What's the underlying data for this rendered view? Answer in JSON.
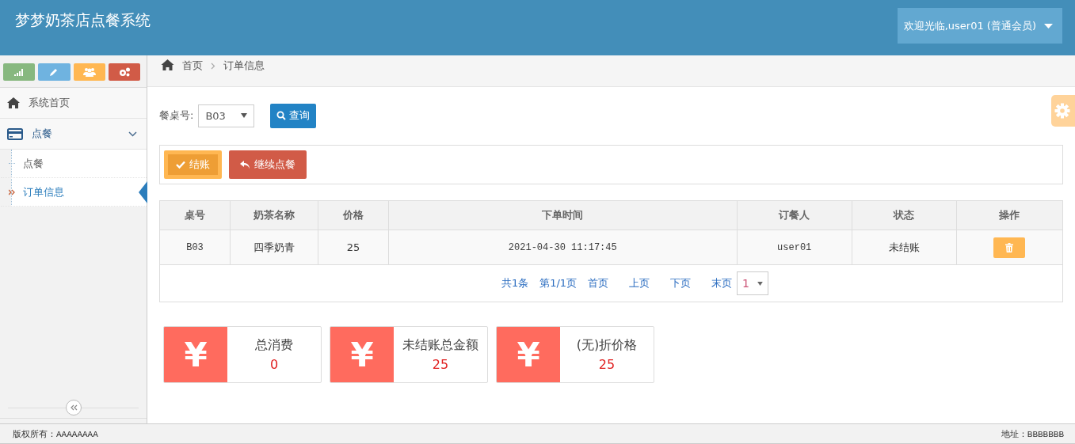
{
  "header": {
    "title": "梦梦奶茶店点餐系统",
    "user_menu": "欢迎光临,user01 (普通会员)"
  },
  "sidebar": {
    "shortcuts": [
      {
        "kind": "stats",
        "color": "#87b87f"
      },
      {
        "kind": "edit",
        "color": "#6fb3e0"
      },
      {
        "kind": "users",
        "color": "#ffb752"
      },
      {
        "kind": "cogs",
        "color": "#d15b47"
      }
    ],
    "items": [
      {
        "label": "系统首页",
        "kind": "home"
      },
      {
        "label": "点餐",
        "kind": "card",
        "expanded": true,
        "children": [
          {
            "label": "点餐",
            "selected": false
          },
          {
            "label": "订单信息",
            "selected": true
          }
        ]
      }
    ]
  },
  "breadcrumb": [
    "首页",
    "订单信息"
  ],
  "filter": {
    "label": "餐桌号:",
    "value": "B03",
    "button": "查询"
  },
  "actions": [
    {
      "kind": "checkout",
      "label": "结账"
    },
    {
      "kind": "back",
      "label": "继续点餐"
    }
  ],
  "table": {
    "columns": [
      "桌号",
      "奶茶名称",
      "价格",
      "下单时间",
      "订餐人",
      "状态",
      "操作"
    ],
    "rows": [
      {
        "cells": [
          "B03",
          "四季奶青",
          "25",
          "2021-04-30 11:17:45",
          "user01",
          "未结账"
        ]
      }
    ]
  },
  "pagination": {
    "summary": "共1条",
    "page": "第1/1页",
    "links": [
      "首页",
      "上页",
      "下页",
      "末页"
    ],
    "current": "1"
  },
  "stats": [
    {
      "label": "总消费",
      "value": "0"
    },
    {
      "label": "未结账总金额",
      "value": "25"
    },
    {
      "label": "(无)折价格",
      "value": "25"
    }
  ],
  "stat_icon": "¥",
  "footer": {
    "left": "版权所有：AAAAAAAA",
    "right": "地址：BBBBBBB"
  }
}
